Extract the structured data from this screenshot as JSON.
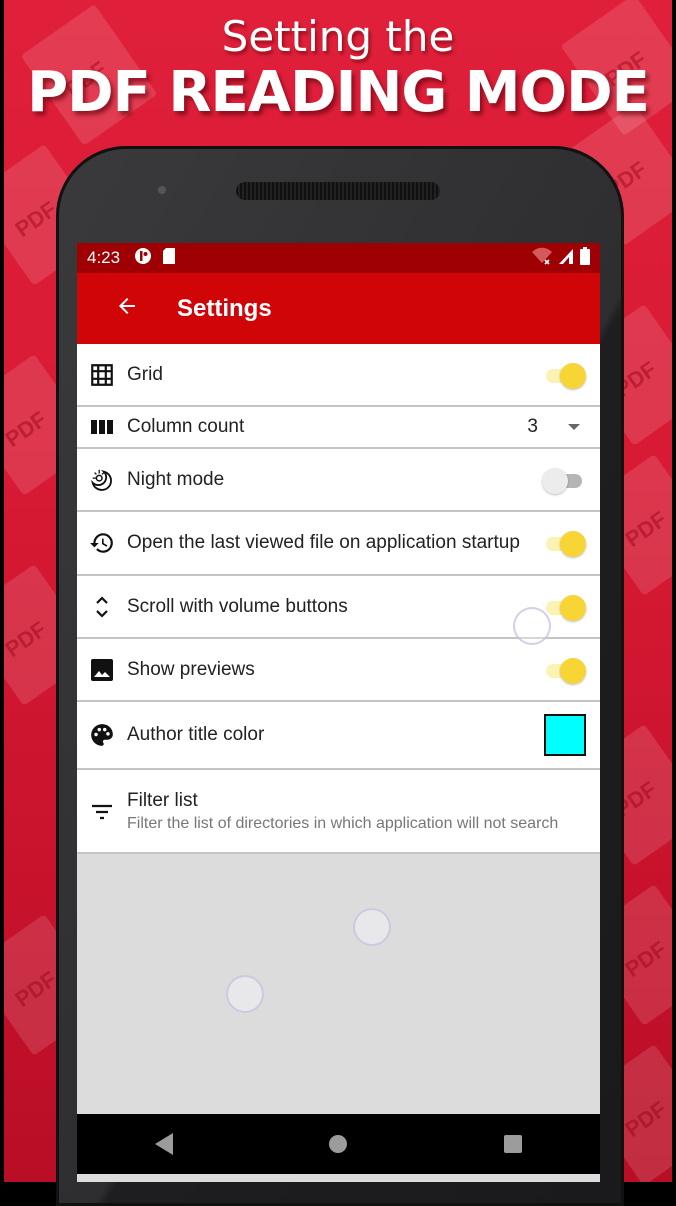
{
  "promo": {
    "line1": "Setting the",
    "line2": "PDF READING MODE",
    "tile_label": "PDF",
    "background_color": "#d81a34"
  },
  "status_bar": {
    "time": "4:23",
    "icons": [
      "app-notification-icon",
      "sd-card-icon",
      "wifi-off-icon",
      "cell-signal-icon",
      "battery-icon"
    ]
  },
  "app_bar": {
    "back_icon": "arrow-left-icon",
    "title": "Settings",
    "color": "#d00508"
  },
  "settings": [
    {
      "icon": "grid-icon",
      "label": "Grid",
      "control": "switch",
      "value": true
    },
    {
      "icon": "columns-icon",
      "label": "Column count",
      "control": "dropdown",
      "value": "3"
    },
    {
      "icon": "night-mode-icon",
      "label": "Night mode",
      "control": "switch",
      "value": false
    },
    {
      "icon": "history-icon",
      "label": "Open the last viewed file on application startup",
      "control": "switch",
      "value": true
    },
    {
      "icon": "unfold-icon",
      "label": "Scroll with volume buttons",
      "control": "switch",
      "value": true
    },
    {
      "icon": "image-icon",
      "label": "Show previews",
      "control": "switch",
      "value": true
    },
    {
      "icon": "palette-icon",
      "label": "Author title color",
      "control": "color",
      "value": "#00ffff"
    },
    {
      "icon": "filter-icon",
      "label": "Filter list",
      "summary": "Filter the list of directories in which application will not search",
      "control": "none"
    }
  ],
  "nav_bar": {
    "buttons": [
      "back",
      "home",
      "recents"
    ]
  },
  "accent": {
    "switch_on": "#f6d535",
    "switch_off": "#ececec"
  }
}
